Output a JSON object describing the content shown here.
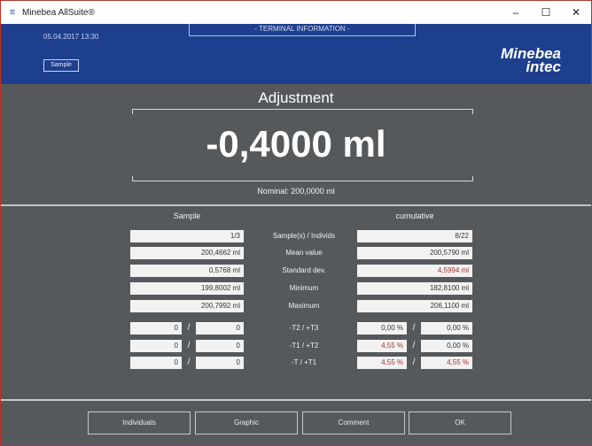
{
  "window": {
    "title": "Minebea AllSuite®",
    "icon": "app-icon",
    "controls": [
      "minimize-icon",
      "maximize-icon",
      "close-icon"
    ]
  },
  "header": {
    "datetime": "05.04.2017 13:30",
    "terminal_label": "- TERMINAL INFORMATION -",
    "sample_button": "Sample",
    "logo_line1": "Minebea",
    "logo_line2": "intec"
  },
  "result": {
    "mode": "Adjustment",
    "value": "-0,4000 ml",
    "nominal": "Nominal: 200,0000 ml"
  },
  "stats": {
    "sample_header": "Sample",
    "cumulative_header": "cumulative",
    "rows": [
      {
        "label": "Sample(s) / Individs",
        "sample": "1/3",
        "cumulative": "8/22"
      },
      {
        "label": "Mean value",
        "sample": "200,4662 ml",
        "cumulative": "200,5790 ml"
      },
      {
        "label": "Standard dev.",
        "sample": "0,5768 ml",
        "cumulative": "4,5994 ml"
      },
      {
        "label": "Minimum",
        "sample": "199,8002 ml",
        "cumulative": "182,8100 ml"
      },
      {
        "label": "Maximum",
        "sample": "200,7992 ml",
        "cumulative": "206,1100 ml"
      }
    ],
    "tolerance_rows": [
      {
        "label": "-T2 / +T3",
        "s_left": "0",
        "s_right": "0",
        "c_left": "0,00 %",
        "c_right": "0,00 %"
      },
      {
        "label": "-T1 / +T2",
        "s_left": "0",
        "s_right": "0",
        "c_left": "4,55 %",
        "c_right": "0,00 %"
      },
      {
        "label": "-T / +T1",
        "s_left": "0",
        "s_right": "0",
        "c_left": "4,55 %",
        "c_right": "4,55 %"
      }
    ],
    "slash": "/"
  },
  "footer": {
    "individuals": "Individuals",
    "graphic": "Graphic",
    "comment": "Comment",
    "ok": "OK"
  },
  "colors": {
    "header_blue": "#1e3f8e",
    "panel_gray": "#56595c",
    "alert_red": "#a8322c"
  }
}
